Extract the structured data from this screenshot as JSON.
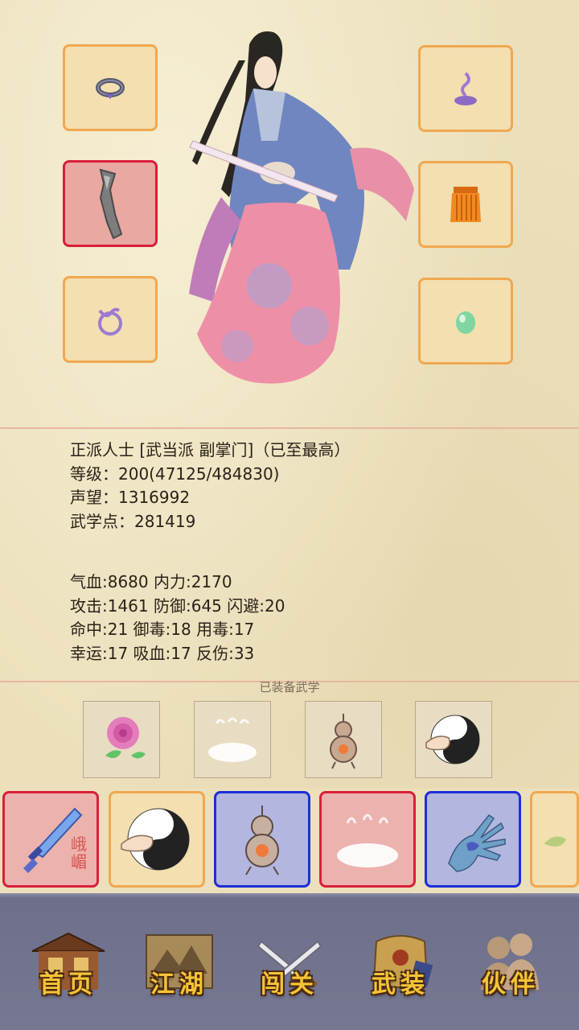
{
  "gear_slots": {
    "left": [
      {
        "icon": "ring-icon"
      },
      {
        "icon": "weapon-blade-icon",
        "selected": true
      },
      {
        "icon": "amulet-icon"
      }
    ],
    "right": [
      {
        "icon": "incense-icon"
      },
      {
        "icon": "armor-skirt-icon"
      },
      {
        "icon": "jade-stone-icon"
      }
    ]
  },
  "character": {
    "title_line": "正派人士 [武当派 副掌门]（已至最高）",
    "level_line": "等级：200(47125/484830)",
    "reputation_line": "声望：1316992",
    "martial_points_line": "武学点：281419"
  },
  "stats": {
    "line1": "气血:8680  内力:2170",
    "line2": "攻击:1461  防御:645  闪避:20",
    "line3": "命中:21  御毒:18  用毒:17",
    "line4": "幸运:17  吸血:17  反伤:33"
  },
  "equipped_skills": {
    "title": "已装备武学",
    "items": [
      "peony-icon",
      "mist-icon",
      "gourd-furnace-icon",
      "taiji-palm-icon"
    ]
  },
  "skill_strip": {
    "items": [
      {
        "icon": "emei-sword-icon",
        "seal": "峨嵋",
        "border": "red"
      },
      {
        "icon": "taiji-palm-icon",
        "border": "orange"
      },
      {
        "icon": "gourd-furnace-icon",
        "border": "blue"
      },
      {
        "icon": "mist-icon",
        "border": "red"
      },
      {
        "icon": "open-palm-icon",
        "border": "blue"
      },
      {
        "icon": "herb-icon",
        "border": "orange"
      }
    ]
  },
  "nav": {
    "home": "首页",
    "jianghu": "江湖",
    "chuangguan": "闯关",
    "wuzhuang": "武装",
    "huoban": "伙伴"
  },
  "colors": {
    "paper": "#ece0bc",
    "slot_border": "#f0a850",
    "selected_border": "#d81f3a",
    "blue_border": "#1c2fd8",
    "nav_label": "#f5c436"
  }
}
